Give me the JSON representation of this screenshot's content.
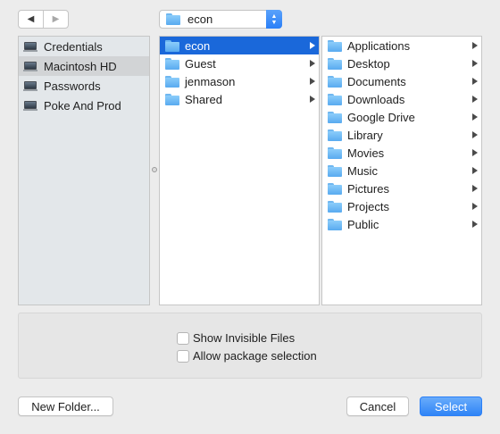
{
  "nav": {
    "back_icon": "◀",
    "forward_icon": "▶"
  },
  "path_popup": {
    "label": "econ"
  },
  "sidebar": {
    "items": [
      {
        "label": "Credentials",
        "selected": false
      },
      {
        "label": "Macintosh HD",
        "selected": true
      },
      {
        "label": "Passwords",
        "selected": false
      },
      {
        "label": "Poke And Prod",
        "selected": false
      }
    ]
  },
  "column1": {
    "items": [
      {
        "label": "econ",
        "selected": true
      },
      {
        "label": "Guest",
        "selected": false
      },
      {
        "label": "jenmason",
        "selected": false
      },
      {
        "label": "Shared",
        "selected": false
      }
    ]
  },
  "column2": {
    "items": [
      {
        "label": "Applications"
      },
      {
        "label": "Desktop"
      },
      {
        "label": "Documents"
      },
      {
        "label": "Downloads"
      },
      {
        "label": "Google Drive"
      },
      {
        "label": "Library"
      },
      {
        "label": "Movies"
      },
      {
        "label": "Music"
      },
      {
        "label": "Pictures"
      },
      {
        "label": "Projects"
      },
      {
        "label": "Public"
      }
    ]
  },
  "options": {
    "show_invisible": {
      "label": "Show Invisible Files",
      "checked": false
    },
    "allow_package": {
      "label": "Allow package selection",
      "checked": false
    }
  },
  "buttons": {
    "new_folder": "New Folder...",
    "cancel": "Cancel",
    "select": "Select"
  },
  "colors": {
    "accent": "#1a68da",
    "sidebar_bg": "#e3e7ea",
    "window_bg": "#ececec"
  }
}
